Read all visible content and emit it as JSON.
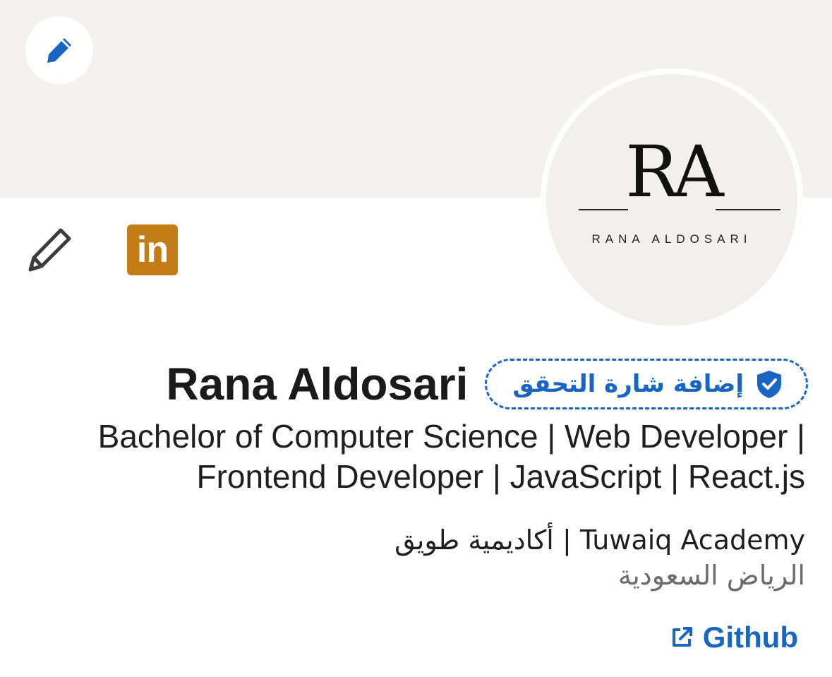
{
  "profile": {
    "name": "Rana Aldosari",
    "verify_label": "إضافة شارة التحقق",
    "headline_line1": "Bachelor of Computer Science | Web Developer |",
    "headline_line2": "Frontend Developer | JavaScript | React.js",
    "organization": "أكاديمية طويق | Tuwaiq Academy",
    "location": "الرياض السعودية",
    "link_label": "Github"
  },
  "avatar": {
    "monogram": "RA",
    "logo_name": "RANA ALDOSARI"
  },
  "icons": {
    "cover_edit": "pencil-icon",
    "profile_edit": "pencil-outline-icon",
    "linkedin": "linkedin-icon",
    "linkedin_text": "in",
    "verify": "shield-check-icon",
    "external": "external-link-icon"
  },
  "colors": {
    "accent": "#1866c2",
    "linkedin": "#c37d16",
    "cover": "#f3f2ef",
    "text": "#1f1f1f",
    "muted": "#6b6b6b"
  }
}
